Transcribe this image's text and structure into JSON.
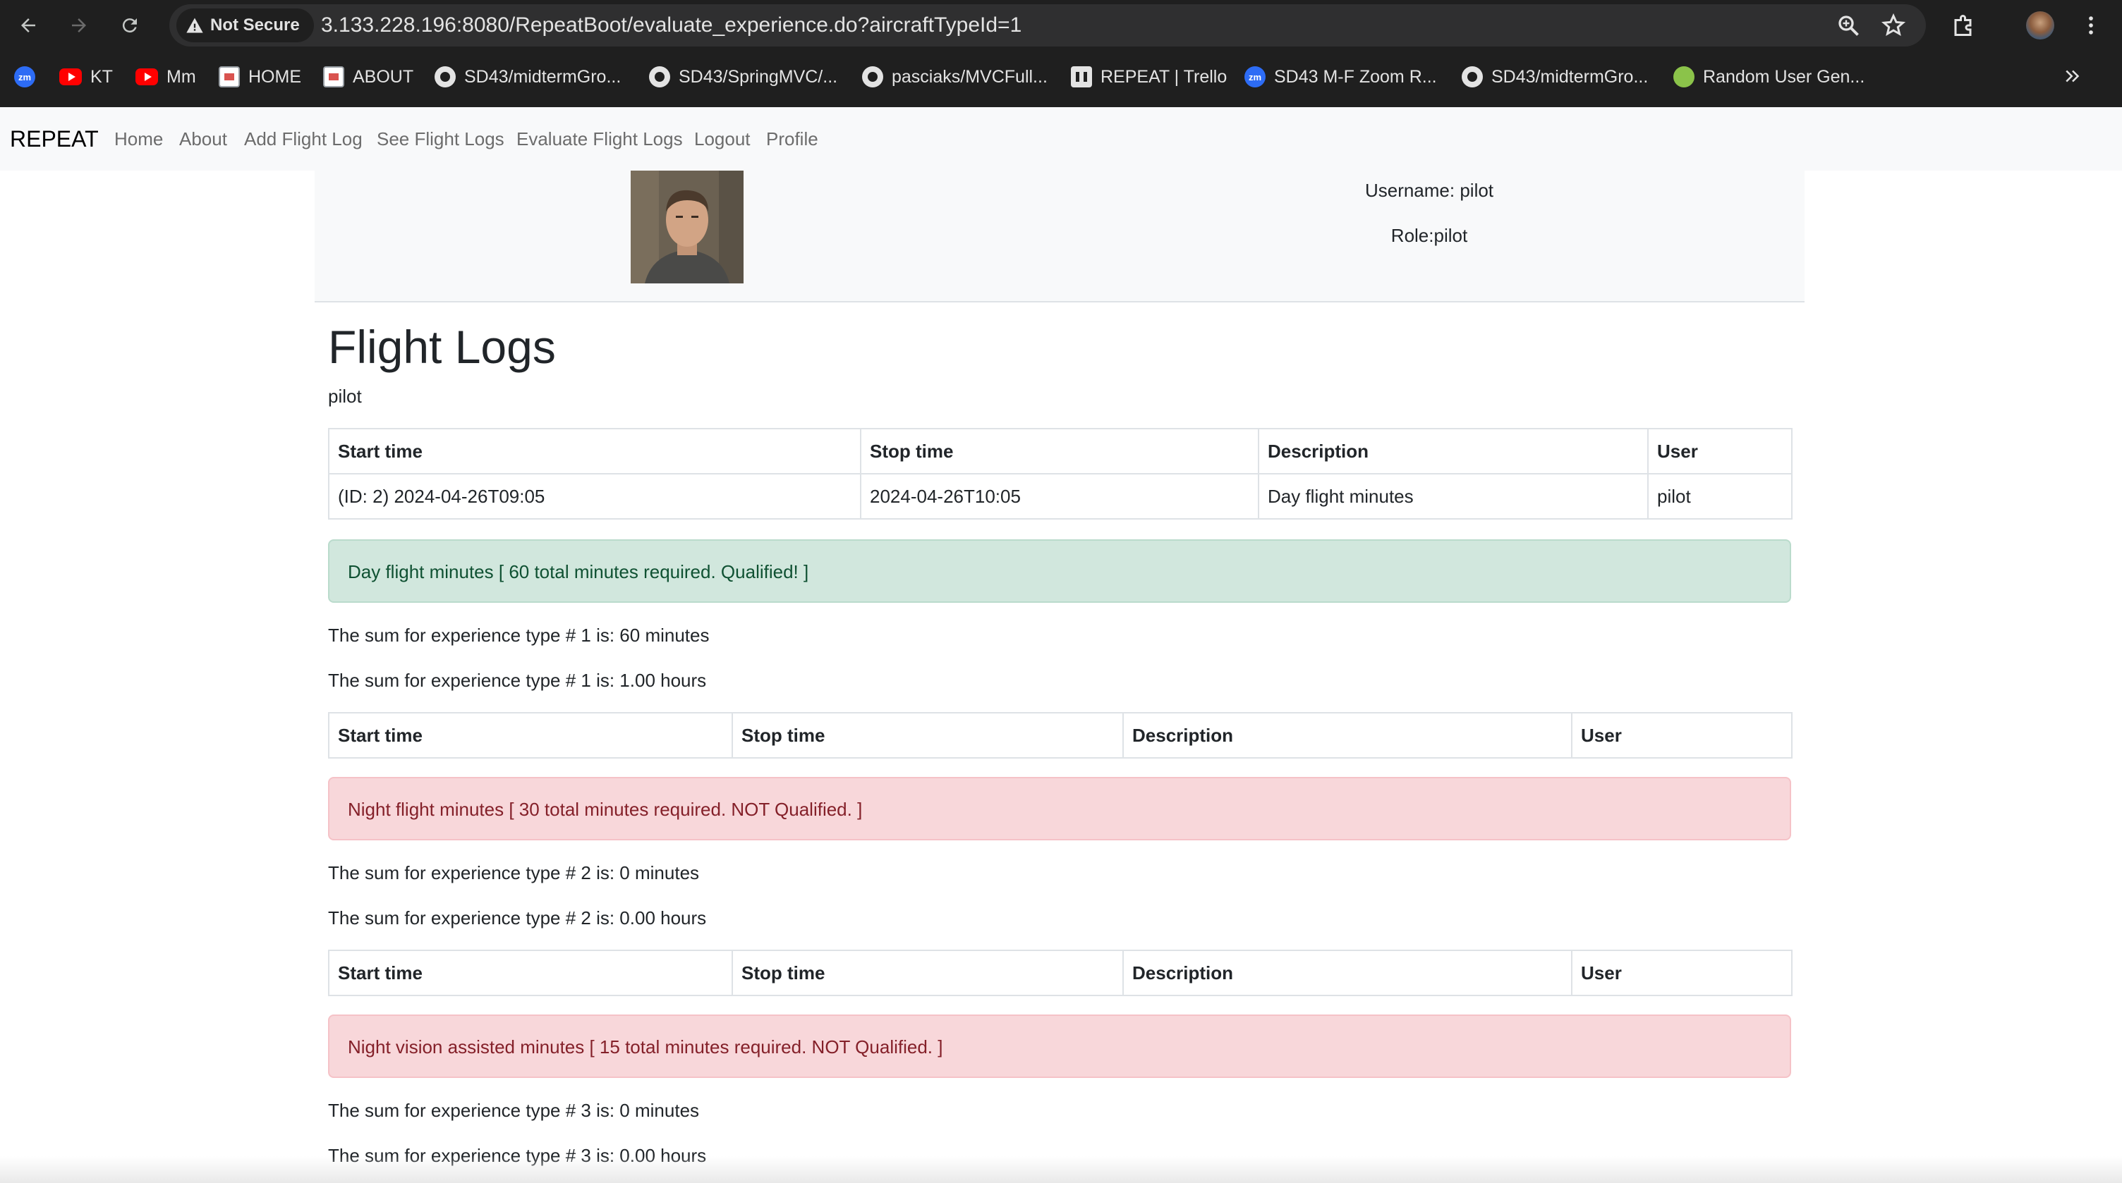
{
  "browser": {
    "security_label": "Not Secure",
    "url": "3.133.228.196:8080/RepeatBoot/evaluate_experience.do?aircraftTypeId=1",
    "bookmarks": [
      {
        "label": "",
        "icon": "zoom-icon"
      },
      {
        "label": "KT",
        "icon": "youtube-icon"
      },
      {
        "label": "Mm",
        "icon": "youtube-icon"
      },
      {
        "label": "HOME",
        "icon": "page-icon"
      },
      {
        "label": "ABOUT",
        "icon": "page-icon"
      },
      {
        "label": "SD43/midtermGro...",
        "icon": "github-icon"
      },
      {
        "label": "SD43/SpringMVC/...",
        "icon": "github-icon"
      },
      {
        "label": "pasciaks/MVCFull...",
        "icon": "github-icon"
      },
      {
        "label": "REPEAT | Trello",
        "icon": "trello-icon"
      },
      {
        "label": "SD43 M-F Zoom R...",
        "icon": "zoom-icon"
      },
      {
        "label": "SD43/midtermGro...",
        "icon": "github-icon"
      },
      {
        "label": "Random User Gen...",
        "icon": "random-user-icon"
      }
    ],
    "zoom_badge": "zm"
  },
  "nav": {
    "brand": "REPEAT",
    "links": [
      "Home",
      "About",
      "Add Flight Log",
      "See Flight Logs",
      "Evaluate Flight Logs",
      "Logout",
      "Profile"
    ]
  },
  "profile": {
    "username_line": "Username: pilot",
    "role_line": "Role:pilot"
  },
  "page": {
    "title": "Flight Logs",
    "subtitle": "pilot"
  },
  "columns": [
    "Start time",
    "Stop time",
    "Description",
    "User"
  ],
  "sections": [
    {
      "rows": [
        [
          "(ID: 2) 2024-04-26T09:05",
          "2024-04-26T10:05",
          "Day flight minutes",
          "pilot"
        ]
      ],
      "alert": "Day flight minutes [ 60 total minutes required. Qualified! ]",
      "status": "success",
      "sum_minutes": "The sum for experience type # 1 is: 60 minutes",
      "sum_hours": "The sum for experience type # 1 is: 1.00 hours"
    },
    {
      "rows": [],
      "alert": "Night flight minutes [ 30 total minutes required. NOT Qualified. ]",
      "status": "danger",
      "sum_minutes": "The sum for experience type # 2 is: 0 minutes",
      "sum_hours": "The sum for experience type # 2 is: 0.00 hours"
    },
    {
      "rows": [],
      "alert": "Night vision assisted minutes [ 15 total minutes required. NOT Qualified. ]",
      "status": "danger",
      "sum_minutes": "The sum for experience type # 3 is: 0 minutes",
      "sum_hours": "The sum for experience type # 3 is: 0.00 hours"
    }
  ],
  "colors": {
    "success_bg": "#d1e7dd",
    "danger_bg": "#f8d7da",
    "navbar_bg": "#f8f9fa",
    "chrome_bg": "#1f1f1f"
  }
}
